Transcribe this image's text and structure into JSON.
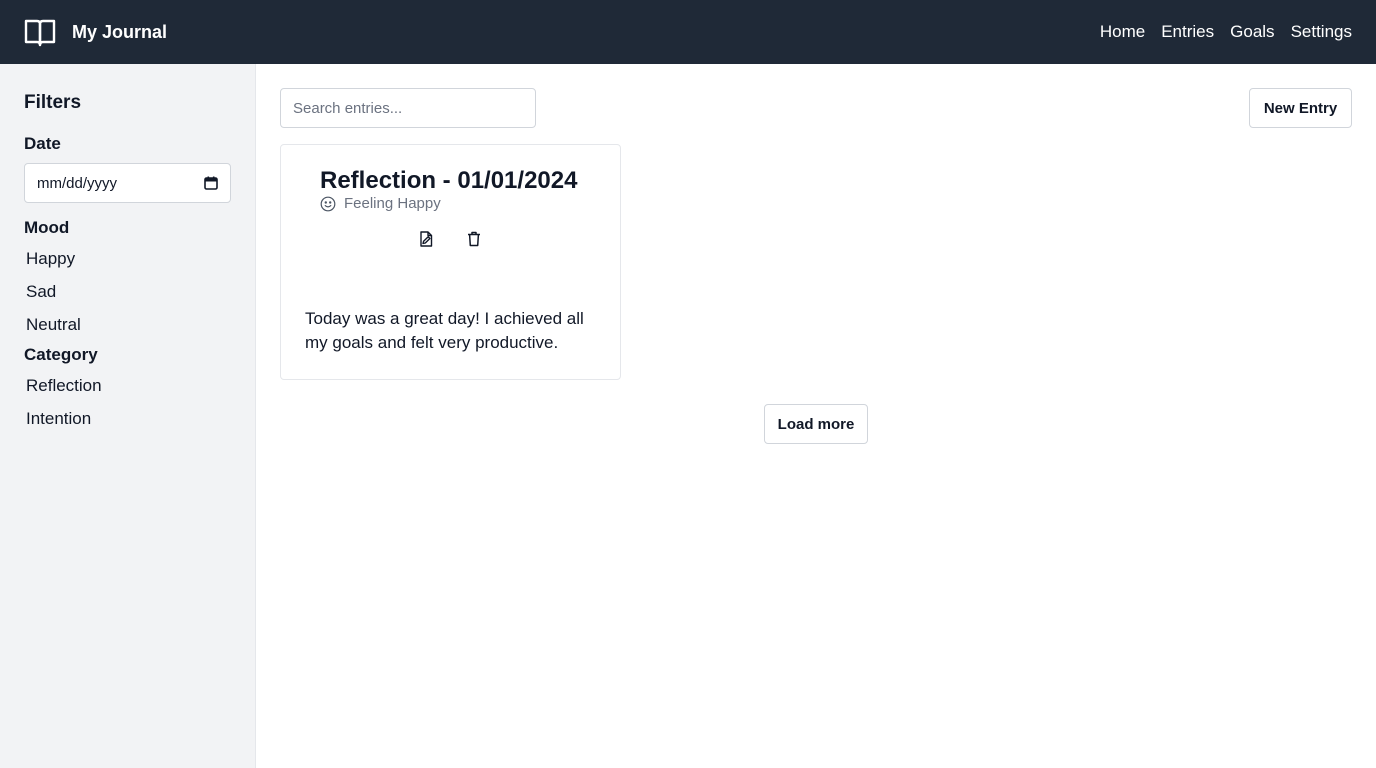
{
  "header": {
    "title": "My Journal",
    "logo_icon": "open-book-icon",
    "nav": [
      {
        "label": "Home"
      },
      {
        "label": "Entries"
      },
      {
        "label": "Goals"
      },
      {
        "label": "Settings"
      }
    ]
  },
  "sidebar": {
    "heading": "Filters",
    "date": {
      "label": "Date",
      "value": "mm/dd/yyyy",
      "icon": "calendar-icon"
    },
    "mood": {
      "label": "Mood",
      "options": [
        "Happy",
        "Sad",
        "Neutral"
      ]
    },
    "category": {
      "label": "Category",
      "options": [
        "Reflection",
        "Intention"
      ]
    }
  },
  "main": {
    "search": {
      "placeholder": "Search entries...",
      "value": ""
    },
    "new_entry_label": "New Entry",
    "load_more_label": "Load more",
    "entries": [
      {
        "title": "Reflection - 01/01/2024",
        "mood_label": "Feeling Happy",
        "mood_icon": "smile-icon",
        "edit_icon": "edit-icon",
        "delete_icon": "trash-icon",
        "body": "Today was a great day! I achieved all my goals and felt very productive."
      }
    ]
  },
  "colors": {
    "header_bg": "#1f2937",
    "sidebar_bg": "#f2f3f5",
    "border": "#d1d5db",
    "muted_text": "#6b7280"
  }
}
